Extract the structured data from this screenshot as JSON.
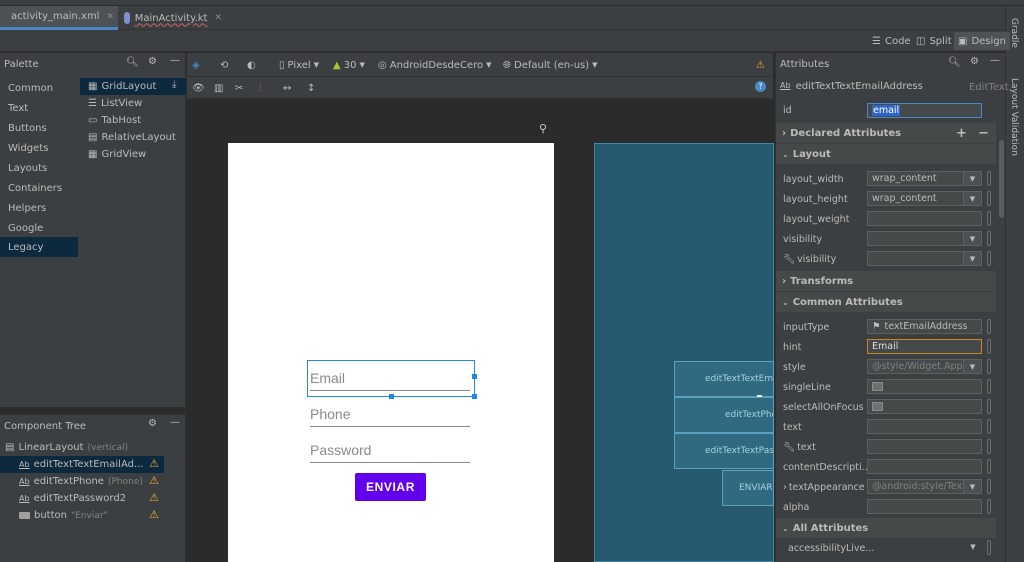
{
  "tabs": [
    {
      "label": "activity_main.xml",
      "icon": "layout-file-icon",
      "active": true
    },
    {
      "label": "MainActivity.kt",
      "icon": "kotlin-file-icon",
      "active": false
    }
  ],
  "right_tool_windows": [
    "Gradle",
    "Layout Validation"
  ],
  "view_modes": {
    "code": "Code",
    "split": "Split",
    "design": "Design",
    "selected": "Design"
  },
  "palette": {
    "title": "Palette",
    "categories": [
      "Common",
      "Text",
      "Buttons",
      "Widgets",
      "Layouts",
      "Containers",
      "Helpers",
      "Google",
      "Legacy"
    ],
    "selected_category": "Legacy",
    "items": [
      "GridLayout",
      "ListView",
      "TabHost",
      "RelativeLayout",
      "GridView"
    ]
  },
  "component_tree": {
    "title": "Component Tree",
    "rows": [
      {
        "label": "LinearLayout",
        "sub": "(vertical)",
        "icon": "linear-layout-icon",
        "warning": false
      },
      {
        "label": "editTextTextEmailAd...",
        "sub": "",
        "icon": "edittext-icon",
        "warning": true
      },
      {
        "label": "editTextPhone",
        "sub": "(Phone)",
        "icon": "edittext-icon",
        "warning": true
      },
      {
        "label": "editTextPassword2",
        "sub": "",
        "icon": "edittext-icon",
        "warning": true
      },
      {
        "label": "button",
        "sub": "\"Enviar\"",
        "icon": "button-icon",
        "warning": true
      }
    ]
  },
  "design_toolbar": {
    "device": "Pixel",
    "api": "30",
    "theme": "AndroidDesdeCero",
    "locale": "Default (en-us)"
  },
  "preview": {
    "email_hint": "Email",
    "phone_hint": "Phone",
    "password_hint": "Password",
    "button_label": "ENVIAR",
    "button_color": "#6200ee"
  },
  "blueprint": {
    "email": "editTextTextEmail",
    "phone": "editTextPhone",
    "password": "editTextTextPassword",
    "button": "ENVIAR"
  },
  "attributes": {
    "title": "Attributes",
    "component_name": "editTextTextEmailAddress",
    "component_type": "EditText",
    "id_label": "id",
    "id_value": "email",
    "sections": {
      "declared": "Declared Attributes",
      "layout": "Layout",
      "transforms": "Transforms",
      "common": "Common Attributes",
      "all": "All Attributes"
    },
    "layout": [
      {
        "label": "layout_width",
        "value": "wrap_content",
        "dropdown": true
      },
      {
        "label": "layout_height",
        "value": "wrap_content",
        "dropdown": true
      },
      {
        "label": "layout_weight",
        "value": "",
        "dropdown": false
      },
      {
        "label": "visibility",
        "value": "",
        "dropdown": true
      },
      {
        "label": "visibility",
        "value": "",
        "dropdown": true,
        "wrench": true
      }
    ],
    "common": [
      {
        "label": "inputType",
        "value": "textEmailAddress",
        "flag": true
      },
      {
        "label": "hint",
        "value": "Email",
        "focused": true
      },
      {
        "label": "style",
        "value": "@style/Widget.App",
        "placeholder": true
      },
      {
        "label": "singleLine",
        "value": "",
        "checkbox": true
      },
      {
        "label": "selectAllOnFocus",
        "value": "",
        "checkbox": true
      },
      {
        "label": "text",
        "value": ""
      },
      {
        "label": "text",
        "value": "",
        "wrench": true
      },
      {
        "label": "contentDescripti...",
        "value": ""
      },
      {
        "label": "textAppearance",
        "value": "@android:style/Tex",
        "placeholder": true,
        "expand": true,
        "dropdown": true
      },
      {
        "label": "alpha",
        "value": ""
      }
    ],
    "all_first": "accessibilityLive..."
  }
}
